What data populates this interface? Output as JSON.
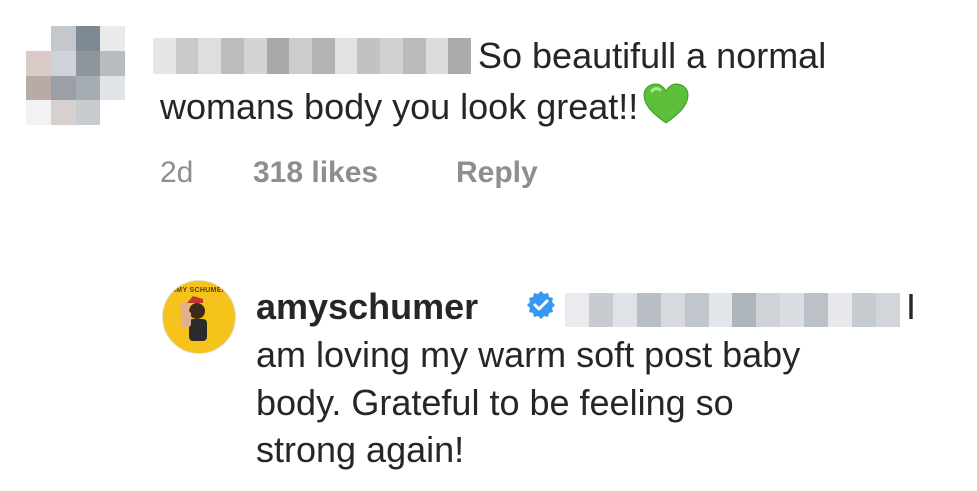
{
  "comment": {
    "text_line1": "So beautifull a normal",
    "text_line2": "womans body you look great!!",
    "emoji": "green-heart",
    "time": "2d",
    "likes": "318 likes",
    "reply_label": "Reply"
  },
  "reply": {
    "username": "amyschumer",
    "verified": true,
    "avatar_caption": "AMY SCHUMER",
    "text_start": "I",
    "lines": [
      "am loving my warm soft post baby",
      "body. Grateful to be feeling so",
      "strong again!"
    ]
  },
  "colors": {
    "text": "#262626",
    "meta": "#8e8e8e",
    "verified": "#3897f0",
    "heart": "#5bbf3a",
    "amy_avatar_bg": "#f6c21c"
  }
}
